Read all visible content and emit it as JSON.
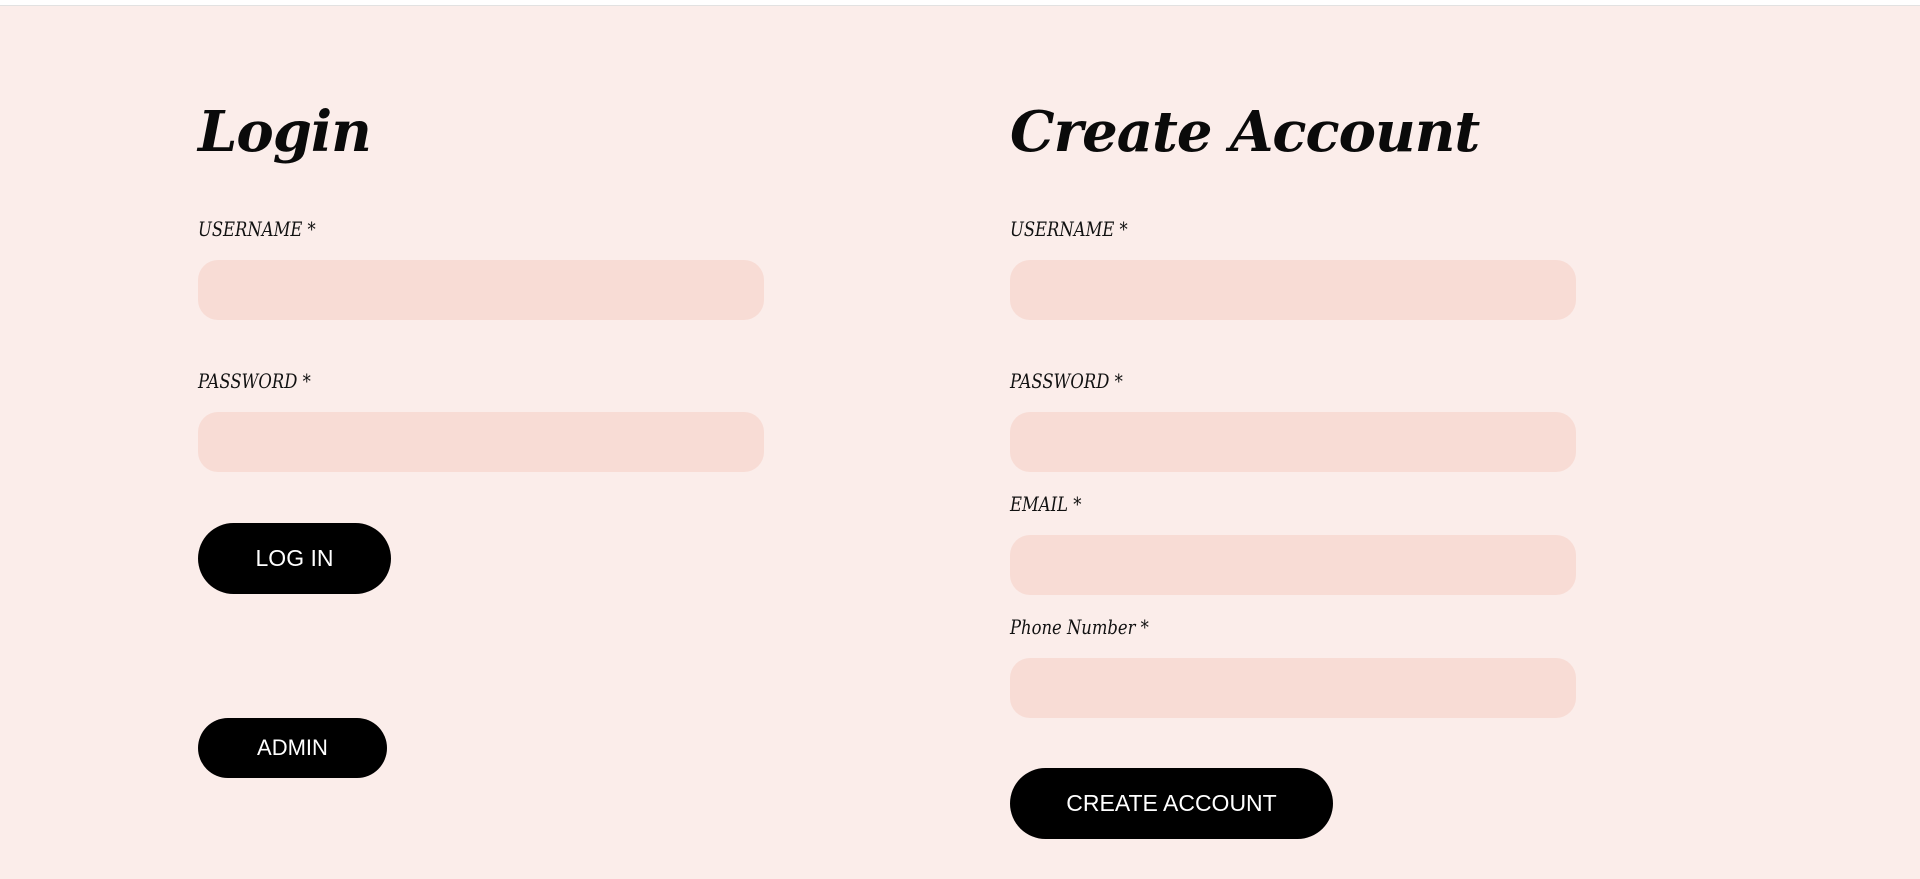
{
  "login": {
    "title": "Login",
    "username_label": "USERNAME *",
    "username_value": "",
    "password_label": "PASSWORD *",
    "password_value": "",
    "login_button": "LOG IN",
    "admin_button": "ADMIN"
  },
  "create_account": {
    "title": "Create Account",
    "username_label": "USERNAME *",
    "username_value": "",
    "password_label": "PASSWORD *",
    "password_value": "",
    "email_label": "EMAIL *",
    "email_value": "",
    "phone_label": "Phone Number *",
    "phone_value": "",
    "submit_button": "CREATE ACCOUNT"
  },
  "colors": {
    "background": "#fbedea",
    "input_fill": "#f8dcd5",
    "button": "#000000",
    "button_text": "#ffffff"
  }
}
